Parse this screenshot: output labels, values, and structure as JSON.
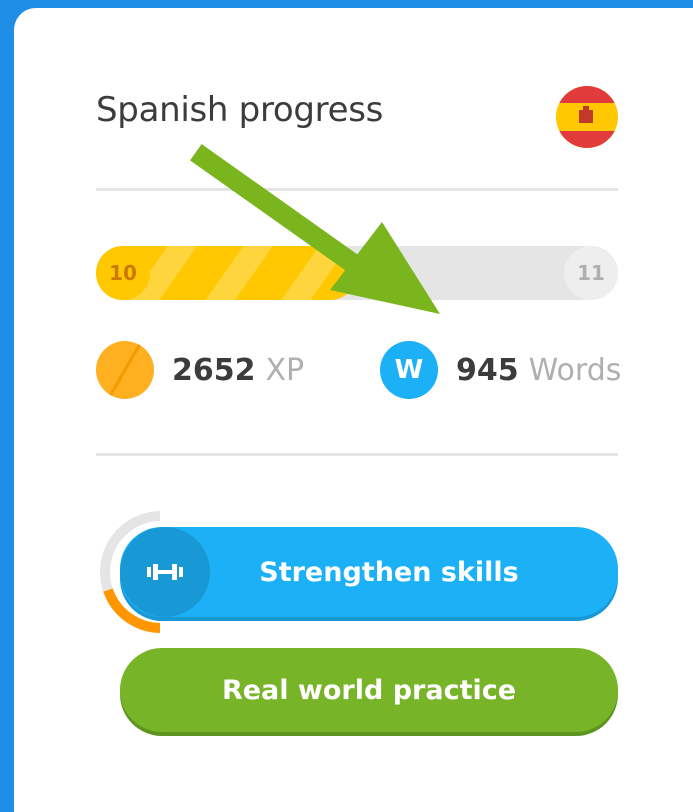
{
  "card": {
    "title": "Spanish progress",
    "flag_icon": "spain-flag-icon"
  },
  "level": {
    "current": "10",
    "next": "11",
    "progress_fraction": 0.5
  },
  "stats": {
    "xp_value": "2652",
    "xp_unit": "XP",
    "words_badge": "W",
    "words_value": "945",
    "words_unit": "Words"
  },
  "actions": {
    "strengthen_label": "Strengthen skills",
    "real_world_label": "Real world practice"
  },
  "colors": {
    "accent_blue": "#1cb0f6",
    "accent_green": "#78b428",
    "xp_gold": "#ffc800",
    "arrow_green": "#7ab51d"
  }
}
